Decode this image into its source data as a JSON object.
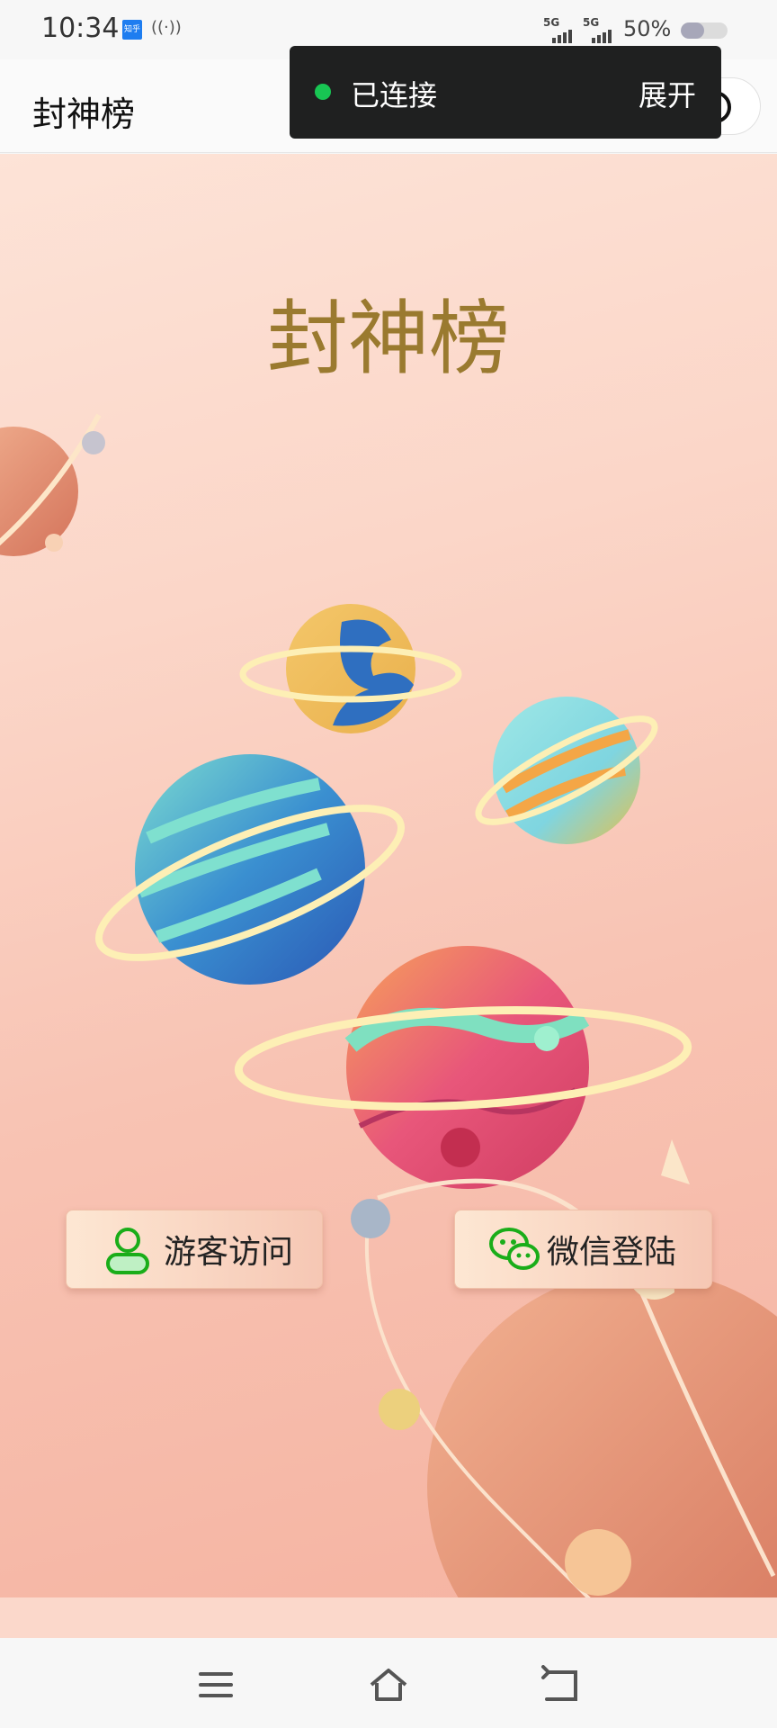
{
  "status_bar": {
    "time": "10:34",
    "app_badge": "知乎",
    "network_1": "5G",
    "network_2": "5G",
    "battery": "50%",
    "battery_level": 0.5
  },
  "nav": {
    "title": "封神榜",
    "more_icon": "more-dots-icon",
    "close_icon": "target-circle-icon"
  },
  "toast": {
    "status": "已连接",
    "action": "展开",
    "status_color": "#18c653"
  },
  "main": {
    "heading": "封神榜",
    "guest_button": "游客访问",
    "wechat_button": "微信登陆"
  },
  "colors": {
    "heading": "#9a7a2f",
    "wechat_icon": "#1aad19",
    "guest_icon": "#1aad19"
  },
  "system_nav": {
    "menu_icon": "menu-icon",
    "home_icon": "home-icon",
    "back_icon": "back-icon"
  }
}
